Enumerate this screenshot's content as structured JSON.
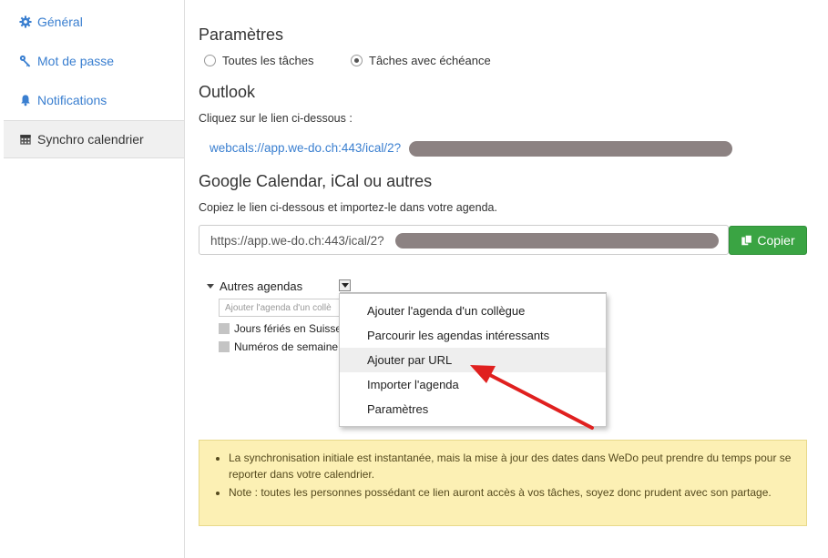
{
  "sidebar": {
    "items": [
      {
        "label": "Général",
        "icon": "gear-icon"
      },
      {
        "label": "Mot de passe",
        "icon": "key-icon"
      },
      {
        "label": "Notifications",
        "icon": "bell-icon"
      },
      {
        "label": "Synchro calendrier",
        "icon": "calendar-icon"
      }
    ],
    "active_index": 3
  },
  "params": {
    "title": "Paramètres",
    "option_all": "Toutes les tâches",
    "option_due": "Tâches avec échéance",
    "selected": "option_due"
  },
  "outlook": {
    "title": "Outlook",
    "instruction": "Cliquez sur le lien ci-dessous :",
    "link": "webcals://app.we-do.ch:443/ical/2?"
  },
  "google": {
    "title": "Google Calendar, iCal ou autres",
    "instruction": "Copiez le lien ci-dessous et importez-le dans votre agenda.",
    "url": "https://app.we-do.ch:443/ical/2?",
    "copy_label": "Copier"
  },
  "calendar": {
    "other_agendas": "Autres agendas",
    "input_placeholder": "Ajouter l'agenda d'un collè",
    "checks": [
      "Jours fériés en Suisse",
      "Numéros de semaine"
    ],
    "menu": [
      "Ajouter l'agenda d'un collègue",
      "Parcourir les agendas intéressants",
      "Ajouter par URL",
      "Importer l'agenda",
      "Paramètres"
    ],
    "hover_index": 2
  },
  "notice": {
    "items": [
      "La synchronisation initiale est instantanée, mais la mise à jour des dates dans WeDo peut prendre du temps pour se reporter dans votre calendrier.",
      "Note : toutes les personnes possédant ce lien auront accès à vos tâches, soyez donc prudent avec son partage."
    ]
  },
  "colors": {
    "link": "#3a7fd0",
    "copy_button": "#3aa443",
    "notice_bg": "#fcf0b4",
    "arrow": "#e0201f",
    "redaction": "#8c8282"
  }
}
